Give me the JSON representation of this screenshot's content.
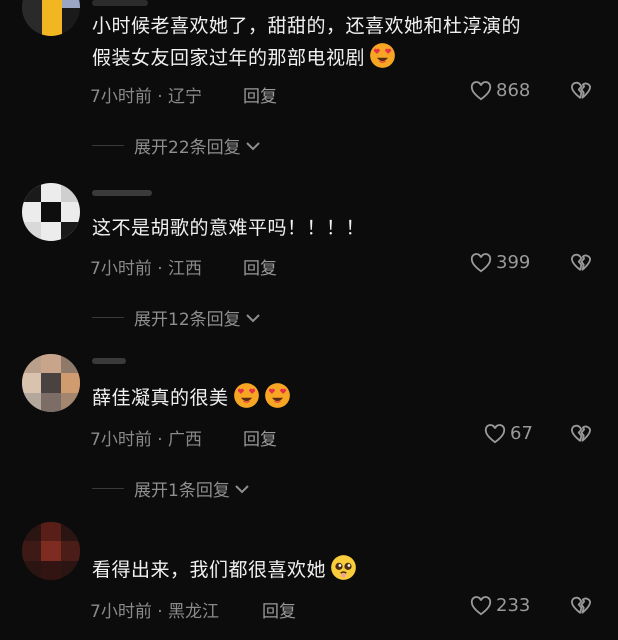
{
  "comments": [
    {
      "line1": "小时候老喜欢她了，甜甜的，还喜欢她和杜淳演的",
      "line2": "假装女友回家过年的那部电视剧",
      "time_loc": "7小时前 · 辽宁",
      "reply": "回复",
      "likes": "868",
      "expand": "展开22条回复"
    },
    {
      "line1": "这不是胡歌的意难平吗！！！！",
      "time_loc": "7小时前 · 江西",
      "reply": "回复",
      "likes": "399",
      "expand": "展开12条回复"
    },
    {
      "line1": "薛佳凝真的很美",
      "time_loc": "7小时前 · 广西",
      "reply": "回复",
      "likes": "67",
      "expand": "展开1条回复"
    },
    {
      "line1": "看得出来，我们都很喜欢她",
      "time_loc": "7小时前 · 黑龙江",
      "reply": "回复",
      "likes": "233"
    }
  ],
  "icons": {
    "like": "heart-outline-icon",
    "dislike": "broken-heart-icon",
    "expand": "chevron-down-icon",
    "emoji_love": "heart-eyes-emoji",
    "emoji_pleading": "pleading-face-emoji"
  }
}
